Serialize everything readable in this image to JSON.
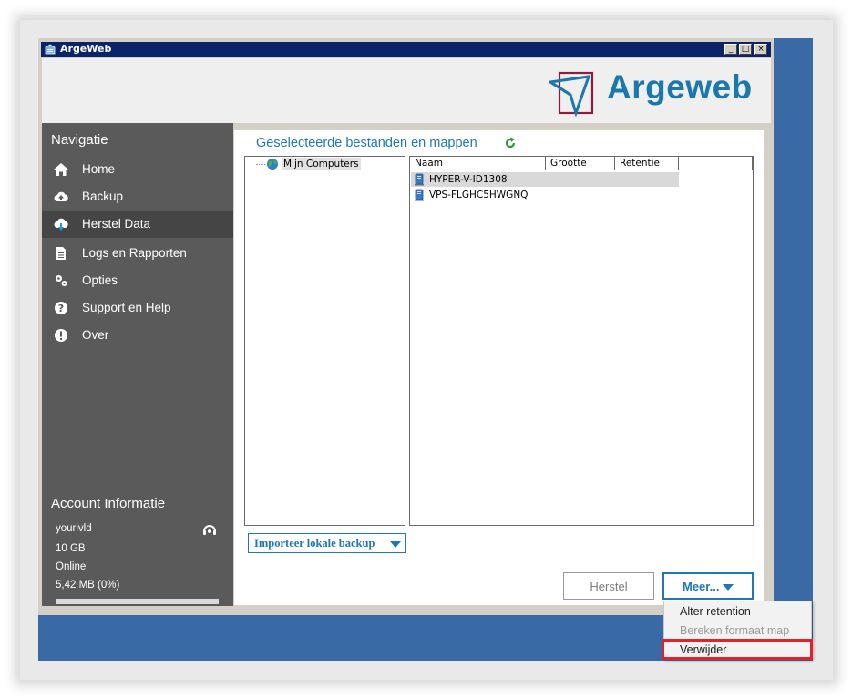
{
  "window": {
    "title": "ArgeWeb",
    "minimize_glyph": "_",
    "maximize_glyph": "□",
    "close_glyph": "×"
  },
  "brand": {
    "logo_text": "Argeweb",
    "logo_color": "#1b78ad",
    "accent_color": "#8c1d3f"
  },
  "sidebar": {
    "title": "Navigatie",
    "items": [
      {
        "label": "Home",
        "icon": "home-icon"
      },
      {
        "label": "Backup",
        "icon": "cloud-upload-icon"
      },
      {
        "label": "Herstel Data",
        "icon": "cloud-download-icon",
        "active": true
      },
      {
        "label": "Logs en Rapporten",
        "icon": "document-icon"
      },
      {
        "label": "Opties",
        "icon": "gears-icon"
      },
      {
        "label": "Support en Help",
        "icon": "question-icon"
      },
      {
        "label": "Over",
        "icon": "info-exclamation-icon"
      }
    ],
    "account": {
      "title": "Account Informatie",
      "username": "yourivld",
      "quota": "10 GB",
      "status": "Online",
      "usage": "5,42 MB (0%)",
      "usage_fraction": 0.0
    }
  },
  "main": {
    "title": "Geselecteerde bestanden en mappen",
    "tree": {
      "root_label": "Mijn Computers"
    },
    "list": {
      "columns": [
        "Naam",
        "Grootte",
        "Retentie"
      ],
      "rows": [
        {
          "name": "HYPER-V-ID1308",
          "selected": true
        },
        {
          "name": "VPS-FLGHC5HWGNQ",
          "selected": false
        }
      ]
    },
    "import_button": "Importeer lokale backup",
    "restore_button": "Herstel",
    "more_button": "Meer..."
  },
  "dropdown": {
    "items": [
      {
        "label": "Alter retention",
        "enabled": true
      },
      {
        "label": "Bereken formaat map",
        "enabled": false
      },
      {
        "label": "Verwijder",
        "enabled": true,
        "highlighted": true
      }
    ],
    "highlight_color": "#e5202a"
  }
}
